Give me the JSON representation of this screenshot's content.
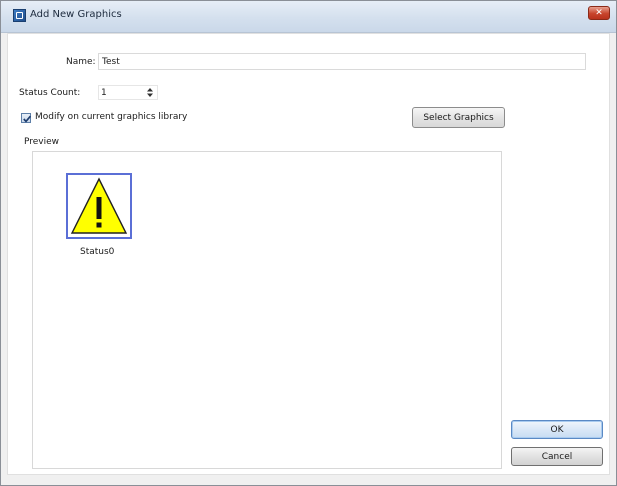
{
  "window": {
    "title": "Add New Graphics",
    "close_glyph": "✕"
  },
  "form": {
    "name_label": "Name:",
    "name_value": "Test",
    "status_count_label": "Status Count:",
    "status_count_value": "1",
    "modify_checkbox_label": "Modify on current graphics library",
    "modify_checked": true,
    "select_graphics_label": "Select Graphics"
  },
  "preview": {
    "label": "Preview",
    "items": [
      {
        "label": "Status0",
        "icon": "warning-triangle-icon"
      }
    ]
  },
  "buttons": {
    "ok_label": "OK",
    "cancel_label": "Cancel"
  },
  "colors": {
    "selection_border": "#5b6fd6",
    "warning_fill": "#ffff00"
  }
}
